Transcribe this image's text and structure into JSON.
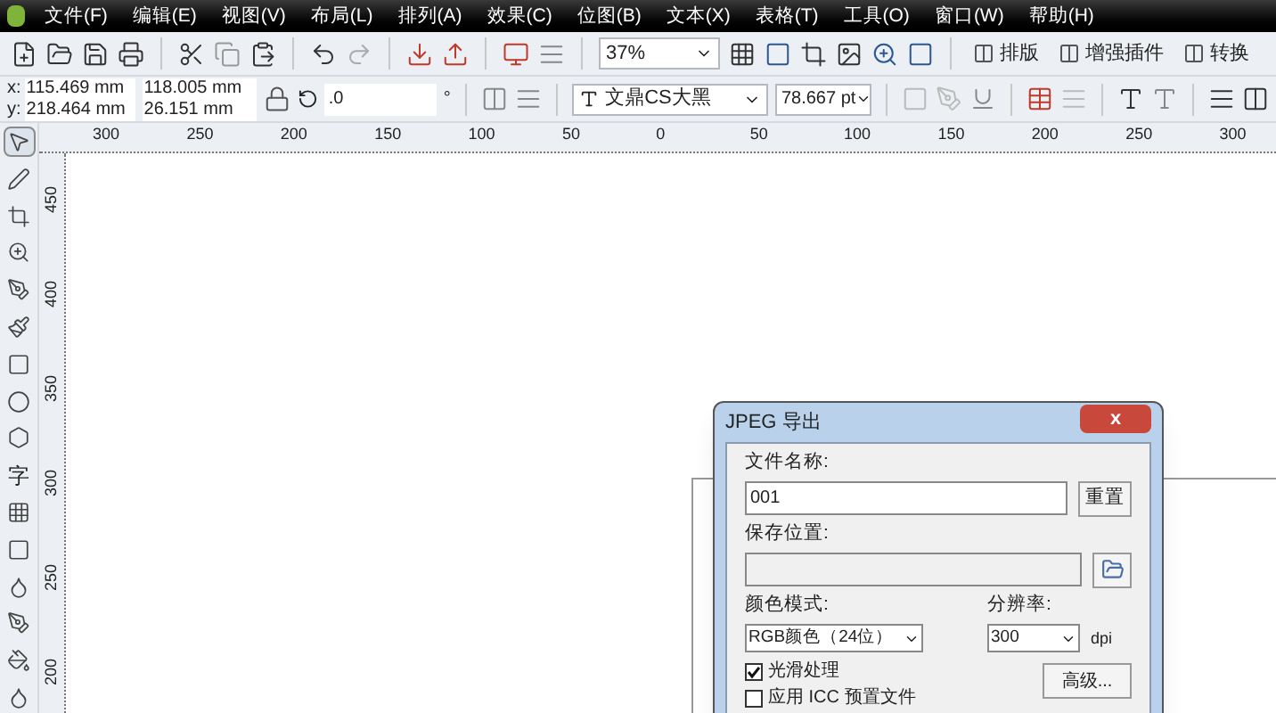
{
  "menu": [
    "文件(F)",
    "编辑(E)",
    "视图(V)",
    "布局(L)",
    "排列(A)",
    "效果(C)",
    "位图(B)",
    "文本(X)",
    "表格(T)",
    "工具(O)",
    "窗口(W)",
    "帮助(H)"
  ],
  "toolbar": {
    "zoom": "37%",
    "buttons": [
      "排版",
      "增强插件",
      "转换"
    ]
  },
  "property_bar": {
    "x_label": "x:",
    "x": "115.469 mm",
    "y_label": "y:",
    "y": "218.464 mm",
    "width": "118.005 mm",
    "height": "26.151 mm",
    "rotation": ".0",
    "degree": "°",
    "font": "文鼎CS大黑",
    "size": "78.667 pt"
  },
  "ruler": {
    "horizontal": [
      "300",
      "250",
      "200",
      "150",
      "100",
      "50",
      "0",
      "50",
      "100",
      "150",
      "200",
      "250",
      "300"
    ],
    "vertical": [
      "450",
      "400",
      "350",
      "300",
      "250",
      "200"
    ]
  },
  "toolbox": [
    {
      "kind": "icon",
      "selected": true
    },
    {
      "kind": "icon",
      "selected": false
    },
    {
      "kind": "icon",
      "selected": false
    },
    {
      "kind": "icon",
      "selected": false
    },
    {
      "kind": "icon",
      "selected": false
    },
    {
      "kind": "icon",
      "selected": false
    },
    {
      "kind": "icon",
      "selected": false
    },
    {
      "kind": "icon",
      "selected": false
    },
    {
      "kind": "icon",
      "selected": false
    },
    {
      "kind": "text",
      "label": "字",
      "selected": false
    },
    {
      "kind": "icon",
      "selected": false
    },
    {
      "kind": "icon",
      "selected": false
    },
    {
      "kind": "icon",
      "selected": false
    },
    {
      "kind": "icon",
      "selected": false
    },
    {
      "kind": "icon",
      "selected": false
    },
    {
      "kind": "icon",
      "selected": false
    }
  ],
  "dialog": {
    "title": "JPEG 导出",
    "close": "x",
    "file_name_label": "文件名称:",
    "file_name": "001",
    "reset": "重置",
    "save_label": "保存位置:",
    "color_mode_label": "颜色模式:",
    "color_mode": "RGB颜色（24位）",
    "resolution_label": "分辨率:",
    "resolution": "300",
    "dpi": "dpi",
    "options": [
      {
        "label": "光滑处理",
        "checked": true
      },
      {
        "label": "应用 ICC 预置文件",
        "checked": false
      }
    ],
    "advanced": "高级..."
  }
}
